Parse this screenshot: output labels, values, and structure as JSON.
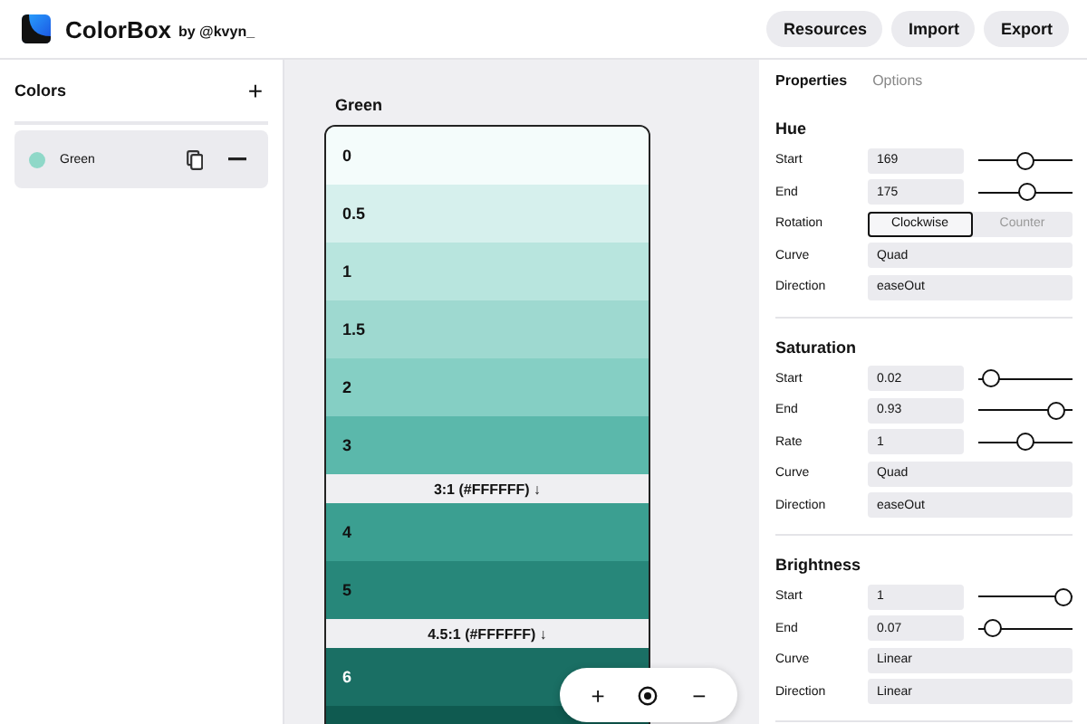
{
  "header": {
    "app_name": "ColorBox",
    "byline": "by @kvyn_",
    "buttons": [
      "Resources",
      "Import",
      "Export"
    ]
  },
  "sidebar": {
    "title": "Colors",
    "add": "+",
    "items": [
      {
        "name": "Green",
        "color": "#8fd8c8",
        "selected": true
      }
    ]
  },
  "palette": {
    "title": "Green",
    "rows": [
      {
        "kind": "swatch",
        "label": "0",
        "color": "#f4fcfb",
        "light_text": false
      },
      {
        "kind": "swatch",
        "label": "0.5",
        "color": "#d6f0ed",
        "light_text": false
      },
      {
        "kind": "swatch",
        "label": "1",
        "color": "#b8e5de",
        "light_text": false
      },
      {
        "kind": "swatch",
        "label": "1.5",
        "color": "#9ed9d0",
        "light_text": false
      },
      {
        "kind": "swatch",
        "label": "2",
        "color": "#85cfc4",
        "light_text": false
      },
      {
        "kind": "swatch",
        "label": "3",
        "color": "#5bb8ab",
        "light_text": false
      },
      {
        "kind": "contrast",
        "label": "3:1 (#FFFFFF) ↓"
      },
      {
        "kind": "swatch",
        "label": "4",
        "color": "#3b9f91",
        "light_text": false
      },
      {
        "kind": "swatch",
        "label": "5",
        "color": "#27877a",
        "light_text": false
      },
      {
        "kind": "contrast",
        "label": "4.5:1 (#FFFFFF) ↓"
      },
      {
        "kind": "swatch",
        "label": "6",
        "color": "#1a6f64",
        "light_text": true
      },
      {
        "kind": "swatch",
        "color": "#0f5a50"
      }
    ]
  },
  "zoom_controls": [
    "+",
    "−"
  ],
  "properties": {
    "tabs": [
      {
        "label": "Properties",
        "selected": true
      },
      {
        "label": "Options",
        "selected": false
      }
    ],
    "sections": [
      {
        "title": "Hue",
        "rows": [
          {
            "kind": "slider",
            "label": "Start",
            "value": "169",
            "level": 0.5
          },
          {
            "kind": "slider",
            "label": "End",
            "value": "175",
            "level": 0.52
          },
          {
            "kind": "toggle",
            "label": "Rotation",
            "options": [
              {
                "label": "Clockwise",
                "selected": true
              },
              {
                "label": "Counter",
                "selected": false
              }
            ]
          },
          {
            "kind": "select",
            "label": "Curve",
            "value": "Quad"
          },
          {
            "kind": "select",
            "label": "Direction",
            "value": "easeOut"
          }
        ]
      },
      {
        "title": "Saturation",
        "rows": [
          {
            "kind": "slider",
            "label": "Start",
            "value": "0.02",
            "level": 0.04
          },
          {
            "kind": "slider",
            "label": "End",
            "value": "0.93",
            "level": 0.9
          },
          {
            "kind": "slider",
            "label": "Rate",
            "value": "1",
            "level": 0.5
          },
          {
            "kind": "select",
            "label": "Curve",
            "value": "Quad"
          },
          {
            "kind": "select",
            "label": "Direction",
            "value": "easeOut"
          }
        ]
      },
      {
        "title": "Brightness",
        "rows": [
          {
            "kind": "slider",
            "label": "Start",
            "value": "1",
            "level": 1
          },
          {
            "kind": "slider",
            "label": "End",
            "value": "0.07",
            "level": 0.08
          },
          {
            "kind": "select",
            "label": "Curve",
            "value": "Linear"
          },
          {
            "kind": "select",
            "label": "Direction",
            "value": "Linear"
          }
        ]
      }
    ]
  }
}
